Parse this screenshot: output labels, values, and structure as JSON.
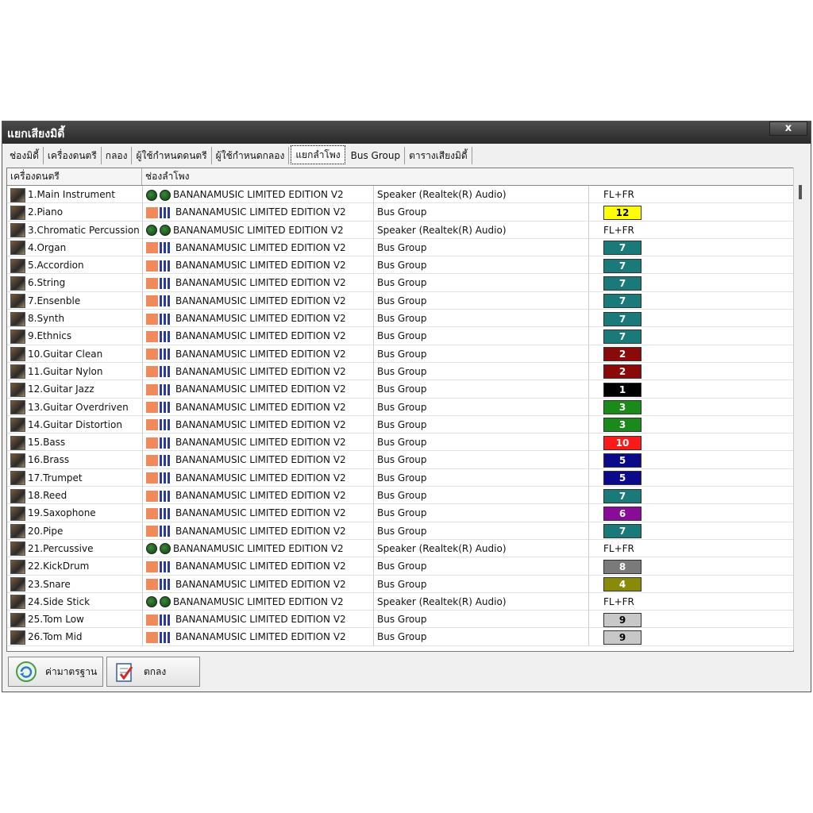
{
  "window": {
    "title": "แยกเสียงมิดี้",
    "close_label": "x"
  },
  "tabs": [
    {
      "label": "ช่องมิดี้"
    },
    {
      "label": "เครื่องดนตรี"
    },
    {
      "label": "กลอง"
    },
    {
      "label": "ผู้ใช้กำหนดดนตรี"
    },
    {
      "label": "ผู้ใช้กำหนดกลอง"
    },
    {
      "label": "แยกลำโพง",
      "active": true
    },
    {
      "label": "Bus Group"
    },
    {
      "label": "ตารางเสียงมิดี้"
    }
  ],
  "grid": {
    "col_instrument": "เครื่องดนตรี",
    "col_output": "ช่องลำโพง",
    "rows": [
      {
        "instrument": "1.Main Instrument",
        "device": "BANANAMUSIC LIMITED EDITION V2",
        "output": "Speaker (Realtek(R) Audio)",
        "channel": "FL+FR",
        "mode": "speaker"
      },
      {
        "instrument": "2.Piano",
        "device": "BANANAMUSIC LIMITED EDITION V2",
        "output": "Bus Group",
        "channel": "12",
        "mode": "bus",
        "color": "#ffff00",
        "text_color": "#000000"
      },
      {
        "instrument": "3.Chromatic Percussion",
        "device": "BANANAMUSIC LIMITED EDITION V2",
        "output": "Speaker (Realtek(R) Audio)",
        "channel": "FL+FR",
        "mode": "speaker"
      },
      {
        "instrument": "4.Organ",
        "device": "BANANAMUSIC LIMITED EDITION V2",
        "output": "Bus Group",
        "channel": "7",
        "mode": "bus",
        "color": "#1a7a7a",
        "text_color": "#ffffff"
      },
      {
        "instrument": "5.Accordion",
        "device": "BANANAMUSIC LIMITED EDITION V2",
        "output": "Bus Group",
        "channel": "7",
        "mode": "bus",
        "color": "#1a7a7a",
        "text_color": "#ffffff"
      },
      {
        "instrument": "6.String",
        "device": "BANANAMUSIC LIMITED EDITION V2",
        "output": "Bus Group",
        "channel": "7",
        "mode": "bus",
        "color": "#1a7a7a",
        "text_color": "#ffffff"
      },
      {
        "instrument": "7.Ensenble",
        "device": "BANANAMUSIC LIMITED EDITION V2",
        "output": "Bus Group",
        "channel": "7",
        "mode": "bus",
        "color": "#1a7a7a",
        "text_color": "#ffffff"
      },
      {
        "instrument": "8.Synth",
        "device": "BANANAMUSIC LIMITED EDITION V2",
        "output": "Bus Group",
        "channel": "7",
        "mode": "bus",
        "color": "#1a7a7a",
        "text_color": "#ffffff"
      },
      {
        "instrument": "9.Ethnics",
        "device": "BANANAMUSIC LIMITED EDITION V2",
        "output": "Bus Group",
        "channel": "7",
        "mode": "bus",
        "color": "#1a7a7a",
        "text_color": "#ffffff"
      },
      {
        "instrument": "10.Guitar Clean",
        "device": "BANANAMUSIC LIMITED EDITION V2",
        "output": "Bus Group",
        "channel": "2",
        "mode": "bus",
        "color": "#8a0a0a",
        "text_color": "#ffffff"
      },
      {
        "instrument": "11.Guitar Nylon",
        "device": "BANANAMUSIC LIMITED EDITION V2",
        "output": "Bus Group",
        "channel": "2",
        "mode": "bus",
        "color": "#8a0a0a",
        "text_color": "#ffffff"
      },
      {
        "instrument": "12.Guitar Jazz",
        "device": "BANANAMUSIC LIMITED EDITION V2",
        "output": "Bus Group",
        "channel": "1",
        "mode": "bus",
        "color": "#000000",
        "text_color": "#ffffff"
      },
      {
        "instrument": "13.Guitar Overdriven",
        "device": "BANANAMUSIC LIMITED EDITION V2",
        "output": "Bus Group",
        "channel": "3",
        "mode": "bus",
        "color": "#1a8a1a",
        "text_color": "#ffffff"
      },
      {
        "instrument": "14.Guitar Distortion",
        "device": "BANANAMUSIC LIMITED EDITION V2",
        "output": "Bus Group",
        "channel": "3",
        "mode": "bus",
        "color": "#1a8a1a",
        "text_color": "#ffffff"
      },
      {
        "instrument": "15.Bass",
        "device": "BANANAMUSIC LIMITED EDITION V2",
        "output": "Bus Group",
        "channel": "10",
        "mode": "bus",
        "color": "#ff1a1a",
        "text_color": "#ffffff"
      },
      {
        "instrument": "16.Brass",
        "device": "BANANAMUSIC LIMITED EDITION V2",
        "output": "Bus Group",
        "channel": "5",
        "mode": "bus",
        "color": "#0a0a8a",
        "text_color": "#ffffff"
      },
      {
        "instrument": "17.Trumpet",
        "device": "BANANAMUSIC LIMITED EDITION V2",
        "output": "Bus Group",
        "channel": "5",
        "mode": "bus",
        "color": "#0a0a8a",
        "text_color": "#ffffff"
      },
      {
        "instrument": "18.Reed",
        "device": "BANANAMUSIC LIMITED EDITION V2",
        "output": "Bus Group",
        "channel": "7",
        "mode": "bus",
        "color": "#1a7a7a",
        "text_color": "#ffffff"
      },
      {
        "instrument": "19.Saxophone",
        "device": "BANANAMUSIC LIMITED EDITION V2",
        "output": "Bus Group",
        "channel": "6",
        "mode": "bus",
        "color": "#8a0a9a",
        "text_color": "#ffffff"
      },
      {
        "instrument": "20.Pipe",
        "device": "BANANAMUSIC LIMITED EDITION V2",
        "output": "Bus Group",
        "channel": "7",
        "mode": "bus",
        "color": "#1a7a7a",
        "text_color": "#ffffff"
      },
      {
        "instrument": "21.Percussive",
        "device": "BANANAMUSIC LIMITED EDITION V2",
        "output": "Speaker (Realtek(R) Audio)",
        "channel": "FL+FR",
        "mode": "speaker"
      },
      {
        "instrument": "22.KickDrum",
        "device": "BANANAMUSIC LIMITED EDITION V2",
        "output": "Bus Group",
        "channel": "8",
        "mode": "bus",
        "color": "#7a7a7a",
        "text_color": "#ffffff"
      },
      {
        "instrument": "23.Snare",
        "device": "BANANAMUSIC LIMITED EDITION V2",
        "output": "Bus Group",
        "channel": "4",
        "mode": "bus",
        "color": "#8a8a0a",
        "text_color": "#ffffff"
      },
      {
        "instrument": "24.Side Stick",
        "device": "BANANAMUSIC LIMITED EDITION V2",
        "output": "Speaker (Realtek(R) Audio)",
        "channel": "FL+FR",
        "mode": "speaker"
      },
      {
        "instrument": "25.Tom Low",
        "device": "BANANAMUSIC LIMITED EDITION V2",
        "output": "Bus Group",
        "channel": "9",
        "mode": "bus",
        "color": "#c8c8c8",
        "text_color": "#000000"
      },
      {
        "instrument": "26.Tom Mid",
        "device": "BANANAMUSIC LIMITED EDITION V2",
        "output": "Bus Group",
        "channel": "9",
        "mode": "bus",
        "color": "#c8c8c8",
        "text_color": "#000000"
      }
    ]
  },
  "buttons": {
    "default_label": "ค่ามาตรฐาน",
    "ok_label": "ตกลง",
    "default_icon": "refresh-icon",
    "ok_icon": "checklist-icon"
  },
  "icons": {
    "speaker_mode": "green-dot-icon",
    "bus_mode_fx": "fx-icon",
    "bus_mode_mixer": "mixer-icon"
  }
}
